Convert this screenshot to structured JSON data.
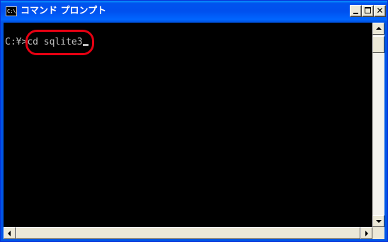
{
  "window": {
    "title": "コマンド プロンプト",
    "icon_label": "C:\\",
    "icon": "console-icon"
  },
  "controls": {
    "minimize_icon": "minimize-icon",
    "maximize_icon": "maximize-icon",
    "close_glyph": "✕"
  },
  "console": {
    "prompt": "C:¥>",
    "command": "cd sqlite3",
    "highlight_color": "#e60012",
    "text_color": "#c0c0c0",
    "background_color": "#000000"
  },
  "scrollbars": {
    "up_icon": "arrow-up-icon",
    "down_icon": "arrow-down-icon",
    "left_icon": "arrow-left-icon",
    "right_icon": "arrow-right-icon"
  },
  "colors": {
    "titlebar": "#0055e5",
    "window_face": "#ece9d8"
  }
}
